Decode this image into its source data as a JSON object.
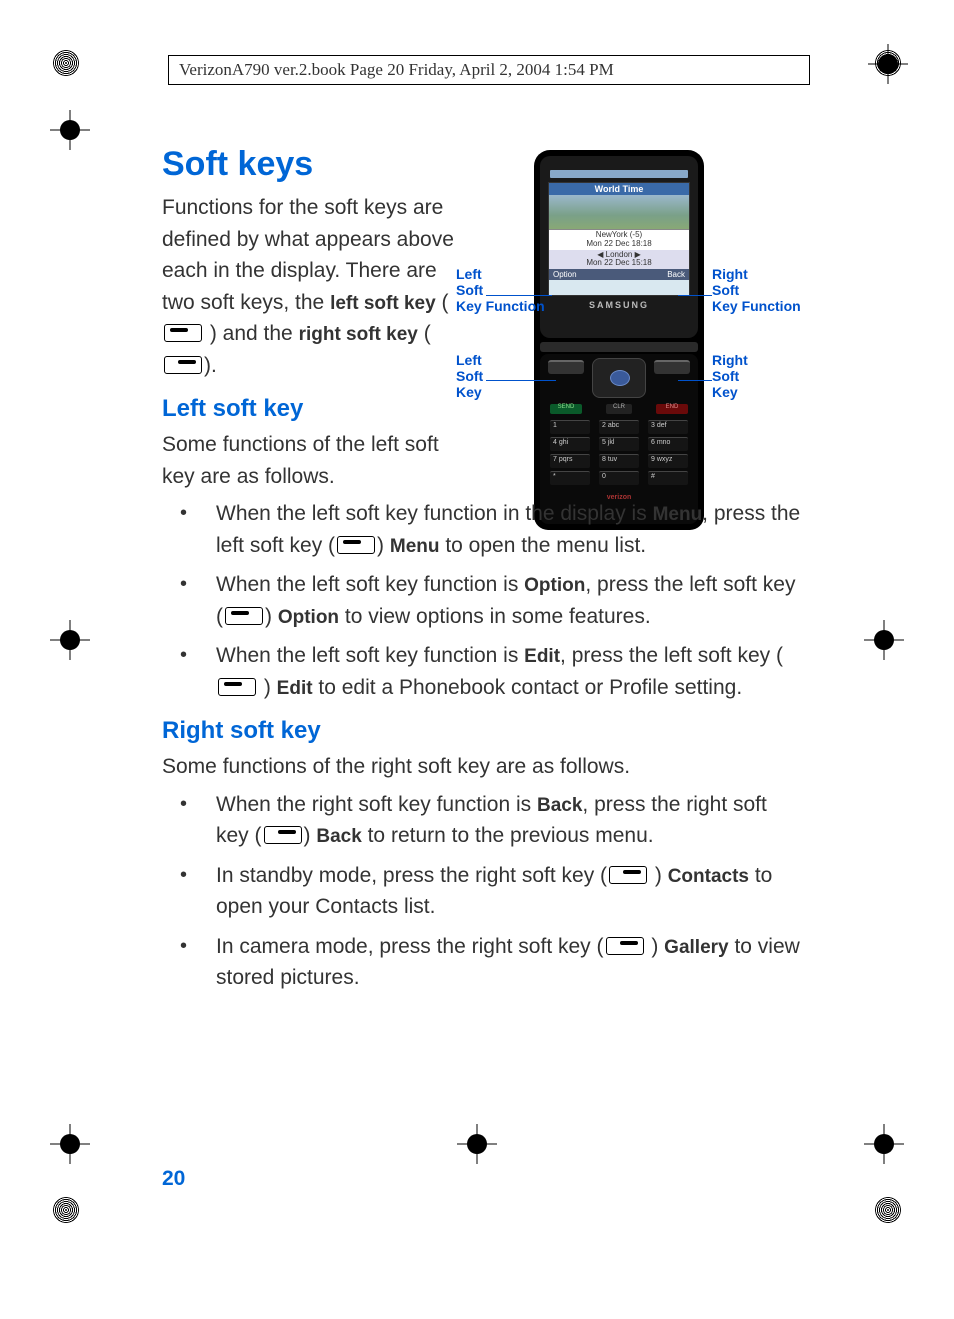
{
  "header": "VerizonA790 ver.2.book  Page 20  Friday, April 2, 2004  1:54 PM",
  "page_number": "20",
  "heading_main": "Soft keys",
  "intro_para": "Functions for the soft keys are defined by what appears above each in the display. There are two soft keys, the ",
  "intro_bold1": "left soft key",
  "intro_mid": " (",
  "intro_mid2": " ) and the ",
  "intro_bold2": "right soft key",
  "intro_end": " (",
  "intro_end2": ").",
  "heading_left": "Left soft key",
  "left_intro": "Some functions of the left soft key are as follows.",
  "left_bullets": [
    {
      "pre": "When the left soft key function in the display is ",
      "b1": "Menu",
      "mid": ", press the left soft key (",
      "b2": "Menu",
      "post": " to open the menu list."
    },
    {
      "pre": "When the left soft key function is ",
      "b1": "Option",
      "mid": ", press the left soft key (",
      "b2": "Option",
      "post": " to view options in some features."
    },
    {
      "pre": "When the left soft key function is ",
      "b1": "Edit",
      "mid": ", press the left soft key (",
      "b2": "Edit",
      "post": " to edit a Phonebook contact or Profile setting."
    }
  ],
  "heading_right": "Right soft key",
  "right_intro": "Some functions of the right soft key are as follows.",
  "right_bullets": [
    {
      "pre": "When the right soft key function is ",
      "b1": "Back",
      "mid": ", press the right soft key (",
      "b2": "Back",
      "post": " to return to the previous menu."
    },
    {
      "pre": "In standby mode, press the right soft key (",
      "b1": "",
      "mid": "",
      "b2": "Contacts",
      "post": " to open your Contacts list."
    },
    {
      "pre": "In camera mode, press the right soft key (",
      "b1": "",
      "mid": "",
      "b2": "Gallery",
      "post": " to view stored pictures."
    }
  ],
  "callouts": {
    "left_func": "Left\nSoft\nKey Function",
    "right_func": "Right\nSoft\nKey Function",
    "left_key": "Left\nSoft\nKey",
    "right_key": "Right\nSoft\nKey"
  },
  "phone": {
    "brand": "SAMSUNG",
    "screen_title": "World Time",
    "city1": "NewYork (-5)",
    "date1": "Mon 22 Dec 18:18",
    "city2": "London",
    "date2": "Mon 22 Dec 15:18",
    "sk_left": "Option",
    "sk_right": "Back",
    "send": "SEND",
    "clr": "CLR",
    "end": "END",
    "carrier": "verizon",
    "keys": [
      [
        "1",
        "2 abc",
        "3 def"
      ],
      [
        "4 ghi",
        "5 jkl",
        "6 mno"
      ],
      [
        "7 pqrs",
        "8 tuv",
        "9 wxyz"
      ],
      [
        "*",
        "0",
        "#"
      ]
    ]
  }
}
